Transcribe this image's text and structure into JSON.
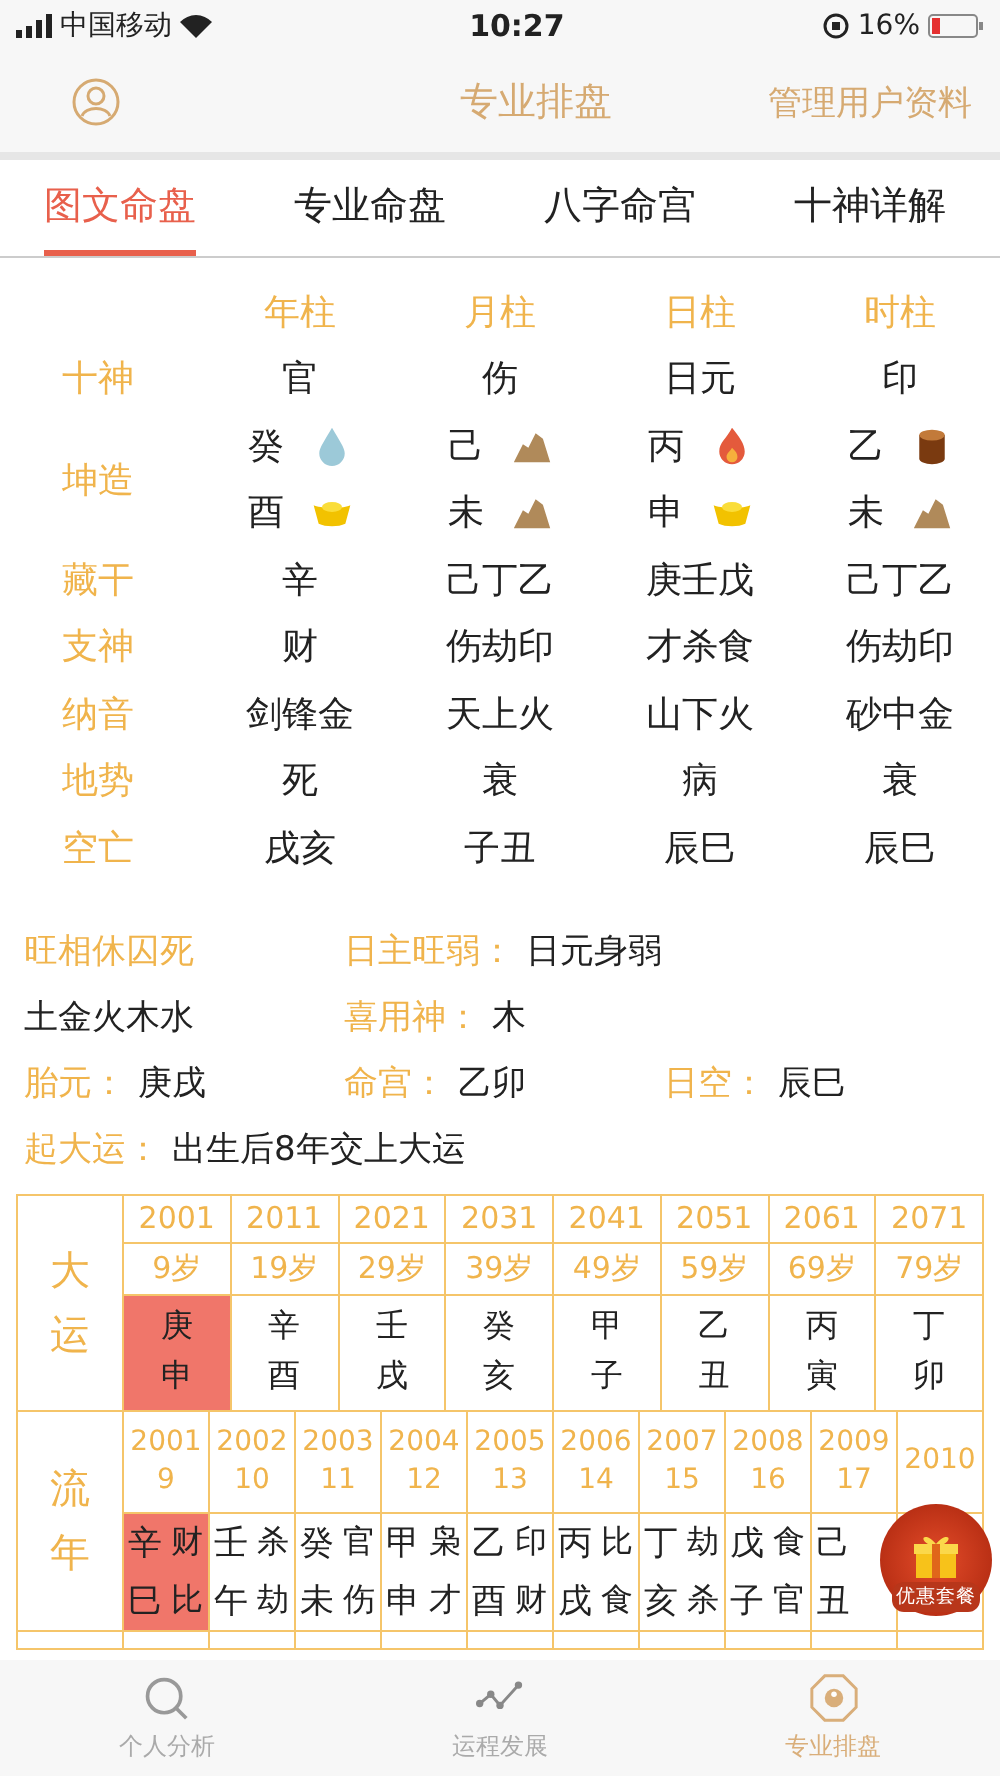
{
  "status_bar": {
    "carrier": "中国移动",
    "time": "10:27",
    "battery": "16%"
  },
  "header": {
    "title": "专业排盘",
    "action": "管理用户资料"
  },
  "tabs": [
    {
      "label": "图文命盘",
      "selected": true
    },
    {
      "label": "专业命盘",
      "selected": false
    },
    {
      "label": "八字命宫",
      "selected": false
    },
    {
      "label": "十神详解",
      "selected": false
    }
  ],
  "pillars": {
    "columns": [
      "年柱",
      "月柱",
      "日柱",
      "时柱"
    ],
    "rows": [
      {
        "kind": "text",
        "label": "十神",
        "values": [
          "官",
          "伤",
          "日元",
          "印"
        ]
      },
      {
        "kind": "ganzhi",
        "label": "坤造",
        "cells": [
          {
            "gan": {
              "char": "癸",
              "kind": "water"
            },
            "zhi": {
              "char": "酉",
              "kind": "metal"
            }
          },
          {
            "gan": {
              "char": "己",
              "kind": "earth"
            },
            "zhi": {
              "char": "未",
              "kind": "earth"
            }
          },
          {
            "gan": {
              "char": "丙",
              "kind": "fire"
            },
            "zhi": {
              "char": "申",
              "kind": "metal"
            }
          },
          {
            "gan": {
              "char": "乙",
              "kind": "wood"
            },
            "zhi": {
              "char": "未",
              "kind": "earth"
            }
          }
        ]
      },
      {
        "kind": "text",
        "label": "藏干",
        "values": [
          "辛",
          "己丁乙",
          "庚壬戊",
          "己丁乙"
        ]
      },
      {
        "kind": "text",
        "label": "支神",
        "values": [
          "财",
          "伤劫印",
          "才杀食",
          "伤劫印"
        ]
      },
      {
        "kind": "text",
        "label": "纳音",
        "values": [
          "剑锋金",
          "天上火",
          "山下火",
          "砂中金"
        ]
      },
      {
        "kind": "text",
        "label": "地势",
        "values": [
          "死",
          "衰",
          "病",
          "衰"
        ]
      },
      {
        "kind": "text",
        "label": "空亡",
        "values": [
          "戌亥",
          "子丑",
          "辰巳",
          "辰巳"
        ]
      }
    ]
  },
  "info": [
    [
      {
        "label": "旺相休囚死"
      },
      {
        "label": "日主旺弱：",
        "value": "日元身弱"
      }
    ],
    [
      {
        "value": "土金火木水"
      },
      {
        "label": "喜用神：",
        "value": "木"
      }
    ],
    [
      {
        "label": "胎元：",
        "value": "庚戌"
      },
      {
        "label": "命宫：",
        "value": "乙卯"
      },
      {
        "label": "日空：",
        "value": "辰巳"
      }
    ],
    [
      {
        "label": "起大运：",
        "value": "出生后8年交上大运"
      }
    ]
  ],
  "dayun": {
    "label": "大运",
    "items": [
      {
        "year": "2001",
        "age": "9岁",
        "gan": "庚",
        "zhi": "申",
        "selected": true
      },
      {
        "year": "2011",
        "age": "19岁",
        "gan": "辛",
        "zhi": "酉",
        "selected": false
      },
      {
        "year": "2021",
        "age": "29岁",
        "gan": "壬",
        "zhi": "戌",
        "selected": false
      },
      {
        "year": "2031",
        "age": "39岁",
        "gan": "癸",
        "zhi": "亥",
        "selected": false
      },
      {
        "year": "2041",
        "age": "49岁",
        "gan": "甲",
        "zhi": "子",
        "selected": false
      },
      {
        "year": "2051",
        "age": "59岁",
        "gan": "乙",
        "zhi": "丑",
        "selected": false
      },
      {
        "year": "2061",
        "age": "69岁",
        "gan": "丙",
        "zhi": "寅",
        "selected": false
      },
      {
        "year": "2071",
        "age": "79岁",
        "gan": "丁",
        "zhi": "卯",
        "selected": false
      }
    ]
  },
  "liunian": {
    "label": "流年",
    "items": [
      {
        "year": "2001",
        "age": "9",
        "gan": "辛",
        "gan_god": "财",
        "zhi": "巳",
        "zhi_god": "比",
        "selected": true
      },
      {
        "year": "2002",
        "age": "10",
        "gan": "壬",
        "gan_god": "杀",
        "zhi": "午",
        "zhi_god": "劫",
        "selected": false
      },
      {
        "year": "2003",
        "age": "11",
        "gan": "癸",
        "gan_god": "官",
        "zhi": "未",
        "zhi_god": "伤",
        "selected": false
      },
      {
        "year": "2004",
        "age": "12",
        "gan": "甲",
        "gan_god": "枭",
        "zhi": "申",
        "zhi_god": "才",
        "selected": false
      },
      {
        "year": "2005",
        "age": "13",
        "gan": "乙",
        "gan_god": "印",
        "zhi": "酉",
        "zhi_god": "财",
        "selected": false
      },
      {
        "year": "2006",
        "age": "14",
        "gan": "丙",
        "gan_god": "比",
        "zhi": "戌",
        "zhi_god": "食",
        "selected": false
      },
      {
        "year": "2007",
        "age": "15",
        "gan": "丁",
        "gan_god": "劫",
        "zhi": "亥",
        "zhi_god": "杀",
        "selected": false
      },
      {
        "year": "2008",
        "age": "16",
        "gan": "戊",
        "gan_god": "食",
        "zhi": "子",
        "zhi_god": "官",
        "selected": false
      },
      {
        "year": "2009",
        "age": "17",
        "gan": "己",
        "zhi": "丑",
        "selected": false
      },
      {
        "year": "2010",
        "selected": false
      }
    ]
  },
  "promo": {
    "label": "优惠套餐"
  },
  "bottom_tabs": [
    {
      "label": "个人分析",
      "kind": "search",
      "selected": false
    },
    {
      "label": "运程发展",
      "kind": "trend",
      "selected": false
    },
    {
      "label": "专业排盘",
      "kind": "bagua",
      "selected": true
    }
  ]
}
